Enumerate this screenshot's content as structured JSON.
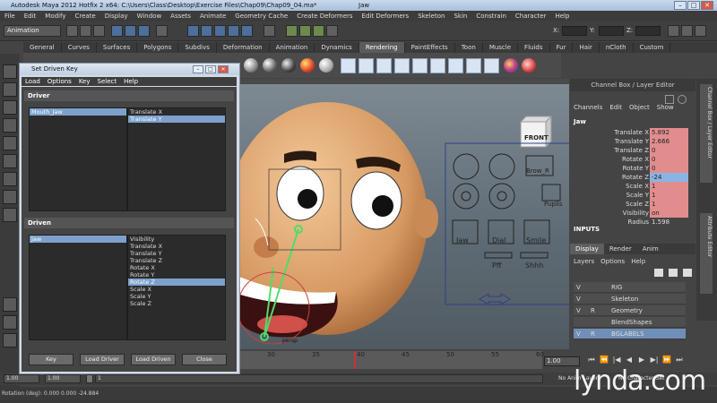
{
  "window": {
    "title": "Autodesk Maya 2012 Hotfix 2 x64: C:\\Users\\Class\\Desktop\\Exercise Files\\Chap09\\Chap09_04.ma*",
    "title_center": "Jaw",
    "controls": [
      "–",
      "□",
      "✕"
    ]
  },
  "menubar": [
    "File",
    "Edit",
    "Modify",
    "Create",
    "Display",
    "Window",
    "Assets",
    "Animate",
    "Geometry Cache",
    "Create Deformers",
    "Edit Deformers",
    "Skeleton",
    "Skin",
    "Constrain",
    "Character",
    "Help"
  ],
  "status_line": {
    "mode": "Animation",
    "field_labels": [
      "X:",
      "Y:",
      "Z:"
    ]
  },
  "shelf_tabs": [
    "General",
    "Curves",
    "Surfaces",
    "Polygons",
    "Subdivs",
    "Deformation",
    "Animation",
    "Dynamics",
    "Rendering",
    "PaintEffects",
    "Toon",
    "Muscle",
    "Fluids",
    "Fur",
    "Hair",
    "nCloth",
    "Custom"
  ],
  "active_shelf_tab": "Rendering",
  "dialog": {
    "title": "Set Driven Key",
    "menu": [
      "Load",
      "Options",
      "Key",
      "Select",
      "Help"
    ],
    "driver_label": "Driver",
    "driver_objects": [
      "Mouth_Jaw"
    ],
    "driver_attributes": [
      "Translate X",
      "Translate Y"
    ],
    "driver_selected_attr_index": 1,
    "driven_label": "Driven",
    "driven_objects": [
      "Jaw"
    ],
    "driven_attributes": [
      "Visibility",
      "Translate X",
      "Translate Y",
      "Translate Z",
      "Rotate X",
      "Rotate Y",
      "Rotate Z",
      "Scale X",
      "Scale Y",
      "Scale Z"
    ],
    "driven_selected_attr_index": 6,
    "buttons": [
      "Key",
      "Load Driver",
      "Load Driven",
      "Close"
    ]
  },
  "viewport": {
    "cube_label": "FRONT",
    "control_labels": [
      "Brow_R",
      "Puplis",
      "Jaw",
      "Dial",
      "Smile",
      "Pff",
      "Shhh"
    ],
    "head_control_label": "persp"
  },
  "channel_box": {
    "header": "Channel Box / Layer Editor",
    "menu": [
      "Channels",
      "Edit",
      "Object",
      "Show"
    ],
    "object": "Jaw",
    "channels": [
      {
        "name": "Translate X",
        "value": "5.892",
        "state": "keyed"
      },
      {
        "name": "Translate Y",
        "value": "2.666",
        "state": "keyed"
      },
      {
        "name": "Translate Z",
        "value": "0",
        "state": "keyed"
      },
      {
        "name": "Rotate X",
        "value": "0",
        "state": "keyed"
      },
      {
        "name": "Rotate Y",
        "value": "0",
        "state": "keyed"
      },
      {
        "name": "Rotate Z",
        "value": "-24",
        "state": "selected"
      },
      {
        "name": "Scale X",
        "value": "1",
        "state": "keyed"
      },
      {
        "name": "Scale Y",
        "value": "1",
        "state": "keyed"
      },
      {
        "name": "Scale Z",
        "value": "1",
        "state": "keyed"
      },
      {
        "name": "Visibility",
        "value": "on",
        "state": "keyed"
      },
      {
        "name": "Radius",
        "value": "1.598",
        "state": "plain"
      }
    ],
    "inputs_label": "INPUTS",
    "display_tabs": [
      "Display",
      "Render",
      "Anim"
    ],
    "layer_menu": [
      "Layers",
      "Options",
      "Help"
    ],
    "layers": [
      {
        "v": "V",
        "r": "",
        "name": "RIG",
        "selected": false
      },
      {
        "v": "V",
        "r": "",
        "name": "Skeleton",
        "selected": false
      },
      {
        "v": "V",
        "r": "R",
        "name": "Geometry",
        "selected": false
      },
      {
        "v": "",
        "r": "",
        "name": "BlendShapes",
        "selected": false
      },
      {
        "v": "V",
        "r": "R",
        "name": "BGLABELS",
        "selected": true
      }
    ],
    "side_tabs": [
      "Channel Box / Layer Editor",
      "Attribute Editor"
    ]
  },
  "timeline": {
    "ticks": [
      "30",
      "35",
      "40",
      "45",
      "50",
      "55",
      "60"
    ],
    "current_frame": "1.00",
    "range_fields": [
      "1.00",
      "1.00",
      "1"
    ],
    "anim_layer": "No Anim Layer",
    "char_set": "No Character Set"
  },
  "help_line": "Rotation (deg): 0.000 0.000 -24.884",
  "watermark": "lynda.com"
}
